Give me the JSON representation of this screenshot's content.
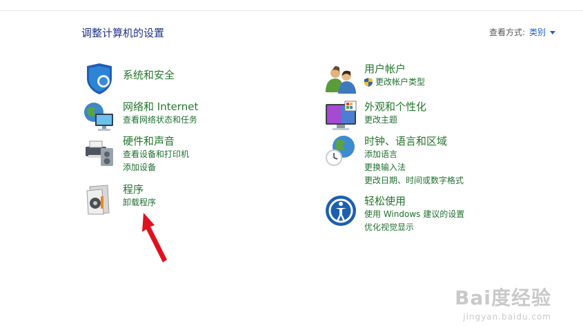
{
  "header": {
    "title": "调整计算机的设置",
    "view_by_label": "查看方式:",
    "view_by_value": "类别"
  },
  "left_column": [
    {
      "title": "系统和安全",
      "links": []
    },
    {
      "title": "网络和 Internet",
      "links": [
        "查看网络状态和任务"
      ]
    },
    {
      "title": "硬件和声音",
      "links": [
        "查看设备和打印机",
        "添加设备"
      ]
    },
    {
      "title": "程序",
      "links": [
        "卸载程序"
      ]
    }
  ],
  "right_column": [
    {
      "title": "用户帐户",
      "links": [
        "更改帐户类型"
      ]
    },
    {
      "title": "外观和个性化",
      "links": [
        "更改主题"
      ]
    },
    {
      "title": "时钟、语言和区域",
      "links": [
        "添加语言",
        "更换输入法",
        "更改日期、时间或数字格式"
      ]
    },
    {
      "title": "轻松使用",
      "links": [
        "使用 Windows 建议的设置",
        "优化视觉显示"
      ]
    }
  ],
  "watermark": {
    "main": "Bai度经验",
    "sub": "jingyan.baidu.com"
  },
  "colors": {
    "category_title": "#22762a",
    "link": "#1f6f2f",
    "page_title": "#1e3287",
    "accent_arrow": "#e0101e"
  },
  "icons": [
    "shield-icon",
    "network-icon",
    "hardware-icon",
    "programs-icon",
    "users-icon",
    "appearance-icon",
    "clock-globe-icon",
    "ease-of-access-icon",
    "uac-shield-icon",
    "red-arrow-icon"
  ]
}
